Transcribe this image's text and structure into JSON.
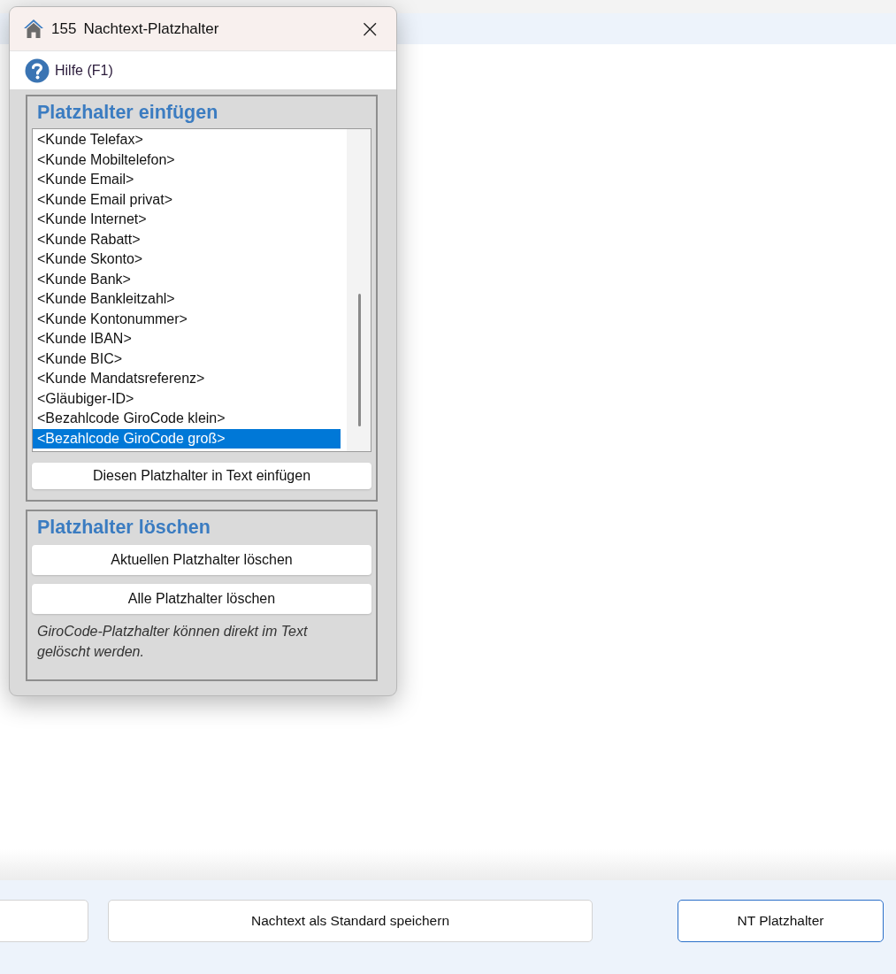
{
  "dialog": {
    "number": "155",
    "title": "Nachtext-Platzhalter",
    "close": "×",
    "help": "Hilfe (F1)",
    "insert_group": {
      "heading": "Platzhalter einfügen",
      "items": [
        {
          "label": "<Kunde Telefax>",
          "selected": false
        },
        {
          "label": "<Kunde Mobiltelefon>",
          "selected": false
        },
        {
          "label": "<Kunde Email>",
          "selected": false
        },
        {
          "label": "<Kunde Email privat>",
          "selected": false
        },
        {
          "label": "<Kunde Internet>",
          "selected": false
        },
        {
          "label": "<Kunde Rabatt>",
          "selected": false
        },
        {
          "label": "<Kunde Skonto>",
          "selected": false
        },
        {
          "label": "<Kunde Bank>",
          "selected": false
        },
        {
          "label": "<Kunde Bankleitzahl>",
          "selected": false
        },
        {
          "label": "<Kunde Kontonummer>",
          "selected": false
        },
        {
          "label": "<Kunde IBAN>",
          "selected": false
        },
        {
          "label": "<Kunde BIC>",
          "selected": false
        },
        {
          "label": "<Kunde Mandatsreferenz>",
          "selected": false
        },
        {
          "label": "<Gläubiger-ID>",
          "selected": false
        },
        {
          "label": "<Bezahlcode GiroCode klein>",
          "selected": false
        },
        {
          "label": "<Bezahlcode GiroCode groß>",
          "selected": true
        }
      ],
      "button": "Diesen Platzhalter in Text einfügen"
    },
    "delete_group": {
      "heading": "Platzhalter löschen",
      "buttons": [
        "Aktuellen Platzhalter löschen",
        "Alle Platzhalter löschen"
      ],
      "note": "GiroCode-Platzhalter können direkt im Text gelöscht werden."
    }
  },
  "bottom_bar": {
    "buttons": [
      {
        "focused": false
      },
      {
        "label": "Nachtext als Standard speichern",
        "focused": false
      },
      {
        "label": "NT Platzhalter",
        "focused": true
      }
    ]
  }
}
